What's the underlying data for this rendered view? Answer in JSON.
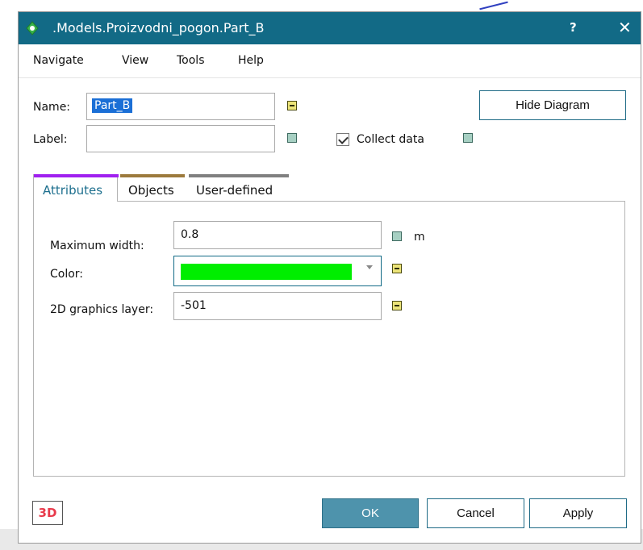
{
  "window": {
    "title": ".Models.Proizvodni_pogon.Part_B",
    "help_label": "?",
    "close_label": "✕"
  },
  "menu": {
    "items": [
      "Navigate",
      "View",
      "Tools",
      "Help"
    ]
  },
  "form": {
    "name_label": "Name:",
    "name_value": "Part_B",
    "label_label": "Label:",
    "label_value": "",
    "collect_data_label": "Collect data",
    "collect_data_checked": true,
    "hide_diagram_label": "Hide Diagram"
  },
  "tabs": [
    {
      "label": "Attributes",
      "color": "#a020f0",
      "active": true
    },
    {
      "label": "Objects",
      "color": "#9c7a3c",
      "active": false
    },
    {
      "label": "User-defined",
      "color": "#808080",
      "active": false
    }
  ],
  "attributes": {
    "max_width_label": "Maximum width:",
    "max_width_value": "0.8",
    "max_width_unit": "m",
    "color_label": "Color:",
    "color_value": "#00ee00",
    "graphics_layer_label": "2D graphics layer:",
    "graphics_layer_value": "-501"
  },
  "footer": {
    "badge_3d": "3D",
    "ok_label": "OK",
    "cancel_label": "Cancel",
    "apply_label": "Apply"
  },
  "colors": {
    "titlebar": "#126a86",
    "ok_button": "#4e93ac",
    "accent": "#1d6f8e"
  }
}
